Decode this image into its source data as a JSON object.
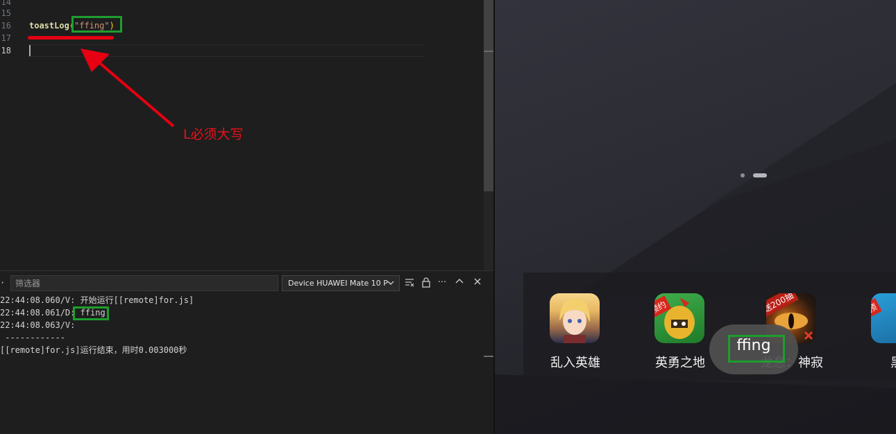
{
  "editor": {
    "lines": [
      {
        "number": "14",
        "text": ""
      },
      {
        "number": "15",
        "text": ""
      },
      {
        "number": "16",
        "fn": "toastLog",
        "open": "(",
        "arg": "\"ffing\"",
        "close": ")"
      },
      {
        "number": "17",
        "text": ""
      },
      {
        "number": "18",
        "text": ""
      }
    ]
  },
  "annotation": {
    "note": "L必须大写",
    "color": "#e60012",
    "highlight_color": "#1d9e2e"
  },
  "log_panel": {
    "toolbar_glyph": "·",
    "filter_placeholder": "筛选器",
    "device_select": "Device HUAWEI Mate 10 P",
    "icons": [
      "clear-format-icon",
      "lock-icon",
      "more-icon",
      "collapse-icon",
      "close-icon"
    ],
    "lines": [
      {
        "text": "22:44:08.060/V: 开始运行[[remote]for.js]"
      },
      {
        "prefix": "22:44:08.061/D: ",
        "value": "ffing"
      },
      {
        "text": "22:44:08.063/V: "
      },
      {
        "text": " ------------"
      },
      {
        "text": "[[remote]for.js]运行结束，用时0.003000秒"
      }
    ]
  },
  "device": {
    "apps": [
      {
        "label": "乱入英雄",
        "icon": "hero-girl-icon"
      },
      {
        "label": "英勇之地",
        "badge": "预约",
        "icon": "spartan-helmet-icon"
      },
      {
        "label": "龙息：神寂",
        "badge": "送200抽",
        "icon": "dragon-eye-icon"
      },
      {
        "label": "黑",
        "badge": "预",
        "icon": "partial-app-icon"
      }
    ],
    "toast": "ffing"
  }
}
